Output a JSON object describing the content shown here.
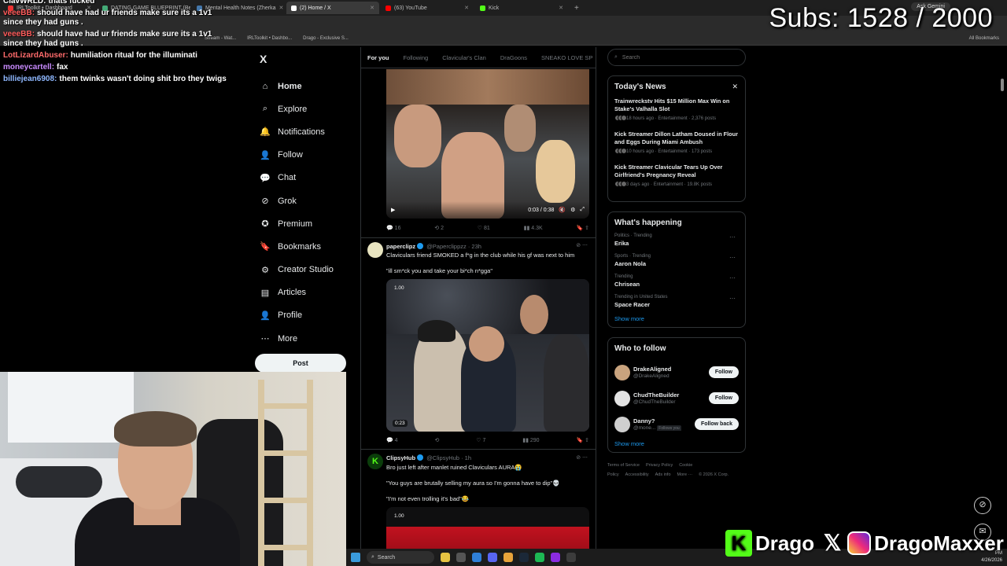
{
  "browser": {
    "tabs": [
      {
        "label": "IRLToolkit • Dashboard",
        "color": "#e33"
      },
      {
        "label": "DATING GAME BLUEPRINT (Be",
        "color": "#4a7"
      },
      {
        "label": "Mental Health Notes (Zherka",
        "color": "#47a"
      },
      {
        "label": "(2) Home / X",
        "color": "#fff",
        "active": true
      },
      {
        "label": "(63) YouTube",
        "color": "#f00"
      },
      {
        "label": "Kick",
        "color": "#53fc18"
      }
    ],
    "ask_gemini": "Ask Gemini",
    "bookmarks": [
      "Stream - Wat...",
      "IRLToolkit • Dashbo...",
      "Drago - Exclusive S..."
    ],
    "all_bookmarks": "All Bookmarks"
  },
  "overlay": {
    "subs": "Subs: 1528 / 2000",
    "chat": [
      {
        "user": "ClavWRLD:",
        "text": "thats fucked",
        "color": "#ffffff"
      },
      {
        "user": "veeeBB:",
        "text": "should have had ur friends make sure its a 1v1 since they had guns .",
        "color": "#ff5c5c"
      },
      {
        "user": "veeeBB:",
        "text": "should have had ur friends make sure its a 1v1 since they had guns .",
        "color": "#ff5c5c"
      },
      {
        "user": "LotLizardAbuser:",
        "text": "humiliation ritual for the illuminati",
        "color": "#ff6b6b"
      },
      {
        "user": "moneycartell:",
        "text": "fax",
        "color": "#c98bff"
      },
      {
        "user": "billiejean6908:",
        "text": "them twinks wasn't doing shit bro they twigs",
        "color": "#8fb8ff"
      }
    ]
  },
  "sidebar": {
    "logo": "X",
    "items": [
      {
        "label": "Home",
        "icon": "⌂",
        "active": true
      },
      {
        "label": "Explore",
        "icon": "⌕"
      },
      {
        "label": "Notifications",
        "icon": "🔔"
      },
      {
        "label": "Follow",
        "icon": "👤"
      },
      {
        "label": "Chat",
        "icon": "💬"
      },
      {
        "label": "Grok",
        "icon": "⊘"
      },
      {
        "label": "Premium",
        "icon": "✪"
      },
      {
        "label": "Bookmarks",
        "icon": "🔖"
      },
      {
        "label": "Creator Studio",
        "icon": "⚙"
      },
      {
        "label": "Articles",
        "icon": "▤"
      },
      {
        "label": "Profile",
        "icon": "👤"
      },
      {
        "label": "More",
        "icon": "⋯"
      }
    ],
    "post_button": "Post"
  },
  "feed": {
    "tabs": [
      "For you",
      "Following",
      "Clavicular's Clan",
      "DraGoons",
      "SNEAKO LOVE SP"
    ],
    "tweet1": {
      "video_time": "0:03 / 0:38",
      "actions": [
        "16",
        "2",
        "81",
        "4.3K"
      ]
    },
    "tweet2": {
      "name": "paperclipz",
      "handle": "@Paperclippzz · 23h",
      "text": "Claviculars friend SMOKED a f*g in the club while his gf was next to him",
      "quote": "\"ill sm*ck you and take your bi*ch n*gga\"",
      "badge": "1.00",
      "duration": "0:23",
      "actions": [
        "4",
        "",
        "7",
        "290"
      ]
    },
    "tweet3": {
      "name": "ClipsyHub",
      "handle": "@ClipsyHub · 1h",
      "text": "Bro just left after manlet ruined Claviculars AURA😭",
      "line2": "\"You guys are brutally selling my aura so I'm gonna have to dip\"💀",
      "line3": "\"I'm not even trolling it's bad\"😂",
      "badge": "1.00"
    }
  },
  "right": {
    "search_placeholder": "Search",
    "news": {
      "title": "Today's News",
      "items": [
        {
          "title": "Trainwreckstv Hits $15 Million Max Win on Stake's Valhalla Slot",
          "meta": "18 hours ago · Entertainment · 2,376 posts"
        },
        {
          "title": "Kick Streamer Dillon Latham Doused in Flour and Eggs During Miami Ambush",
          "meta": "10 hours ago · Entertainment · 173 posts"
        },
        {
          "title": "Kick Streamer Clavicular Tears Up Over Girlfriend's Pregnancy Reveal",
          "meta": "3 days ago · Entertainment · 19.8K posts"
        }
      ]
    },
    "happening": {
      "title": "What's happening",
      "items": [
        {
          "meta": "Politics · Trending",
          "name": "Erika"
        },
        {
          "meta": "Sports · Trending",
          "name": "Aaron Nola"
        },
        {
          "meta": "Trending",
          "name": "Chrisean"
        },
        {
          "meta": "Trending in United States",
          "name": "Space Racer"
        }
      ],
      "show_more": "Show more"
    },
    "who_to_follow": {
      "title": "Who to follow",
      "items": [
        {
          "name": "DrakeAligned",
          "handle": "@DrakeAligned",
          "button": "Follow"
        },
        {
          "name": "ChudTheBuilder",
          "handle": "@ChudTheBuilder",
          "button": "Follow"
        },
        {
          "name": "Danny?",
          "handle": "@mone...",
          "badge": "Follows you",
          "button": "Follow back"
        }
      ],
      "show_more": "Show more"
    },
    "footer": [
      "Terms of Service",
      "Privacy Policy",
      "Cookie Policy",
      "Accessibility",
      "Ads info",
      "More ···",
      "© 2026 X Corp."
    ]
  },
  "taskbar": {
    "search": "Search",
    "time": "PM",
    "date": "4/26/2026"
  },
  "brand": {
    "kick_handle": "Drago",
    "ig_handle": "DragoMaxxer"
  }
}
